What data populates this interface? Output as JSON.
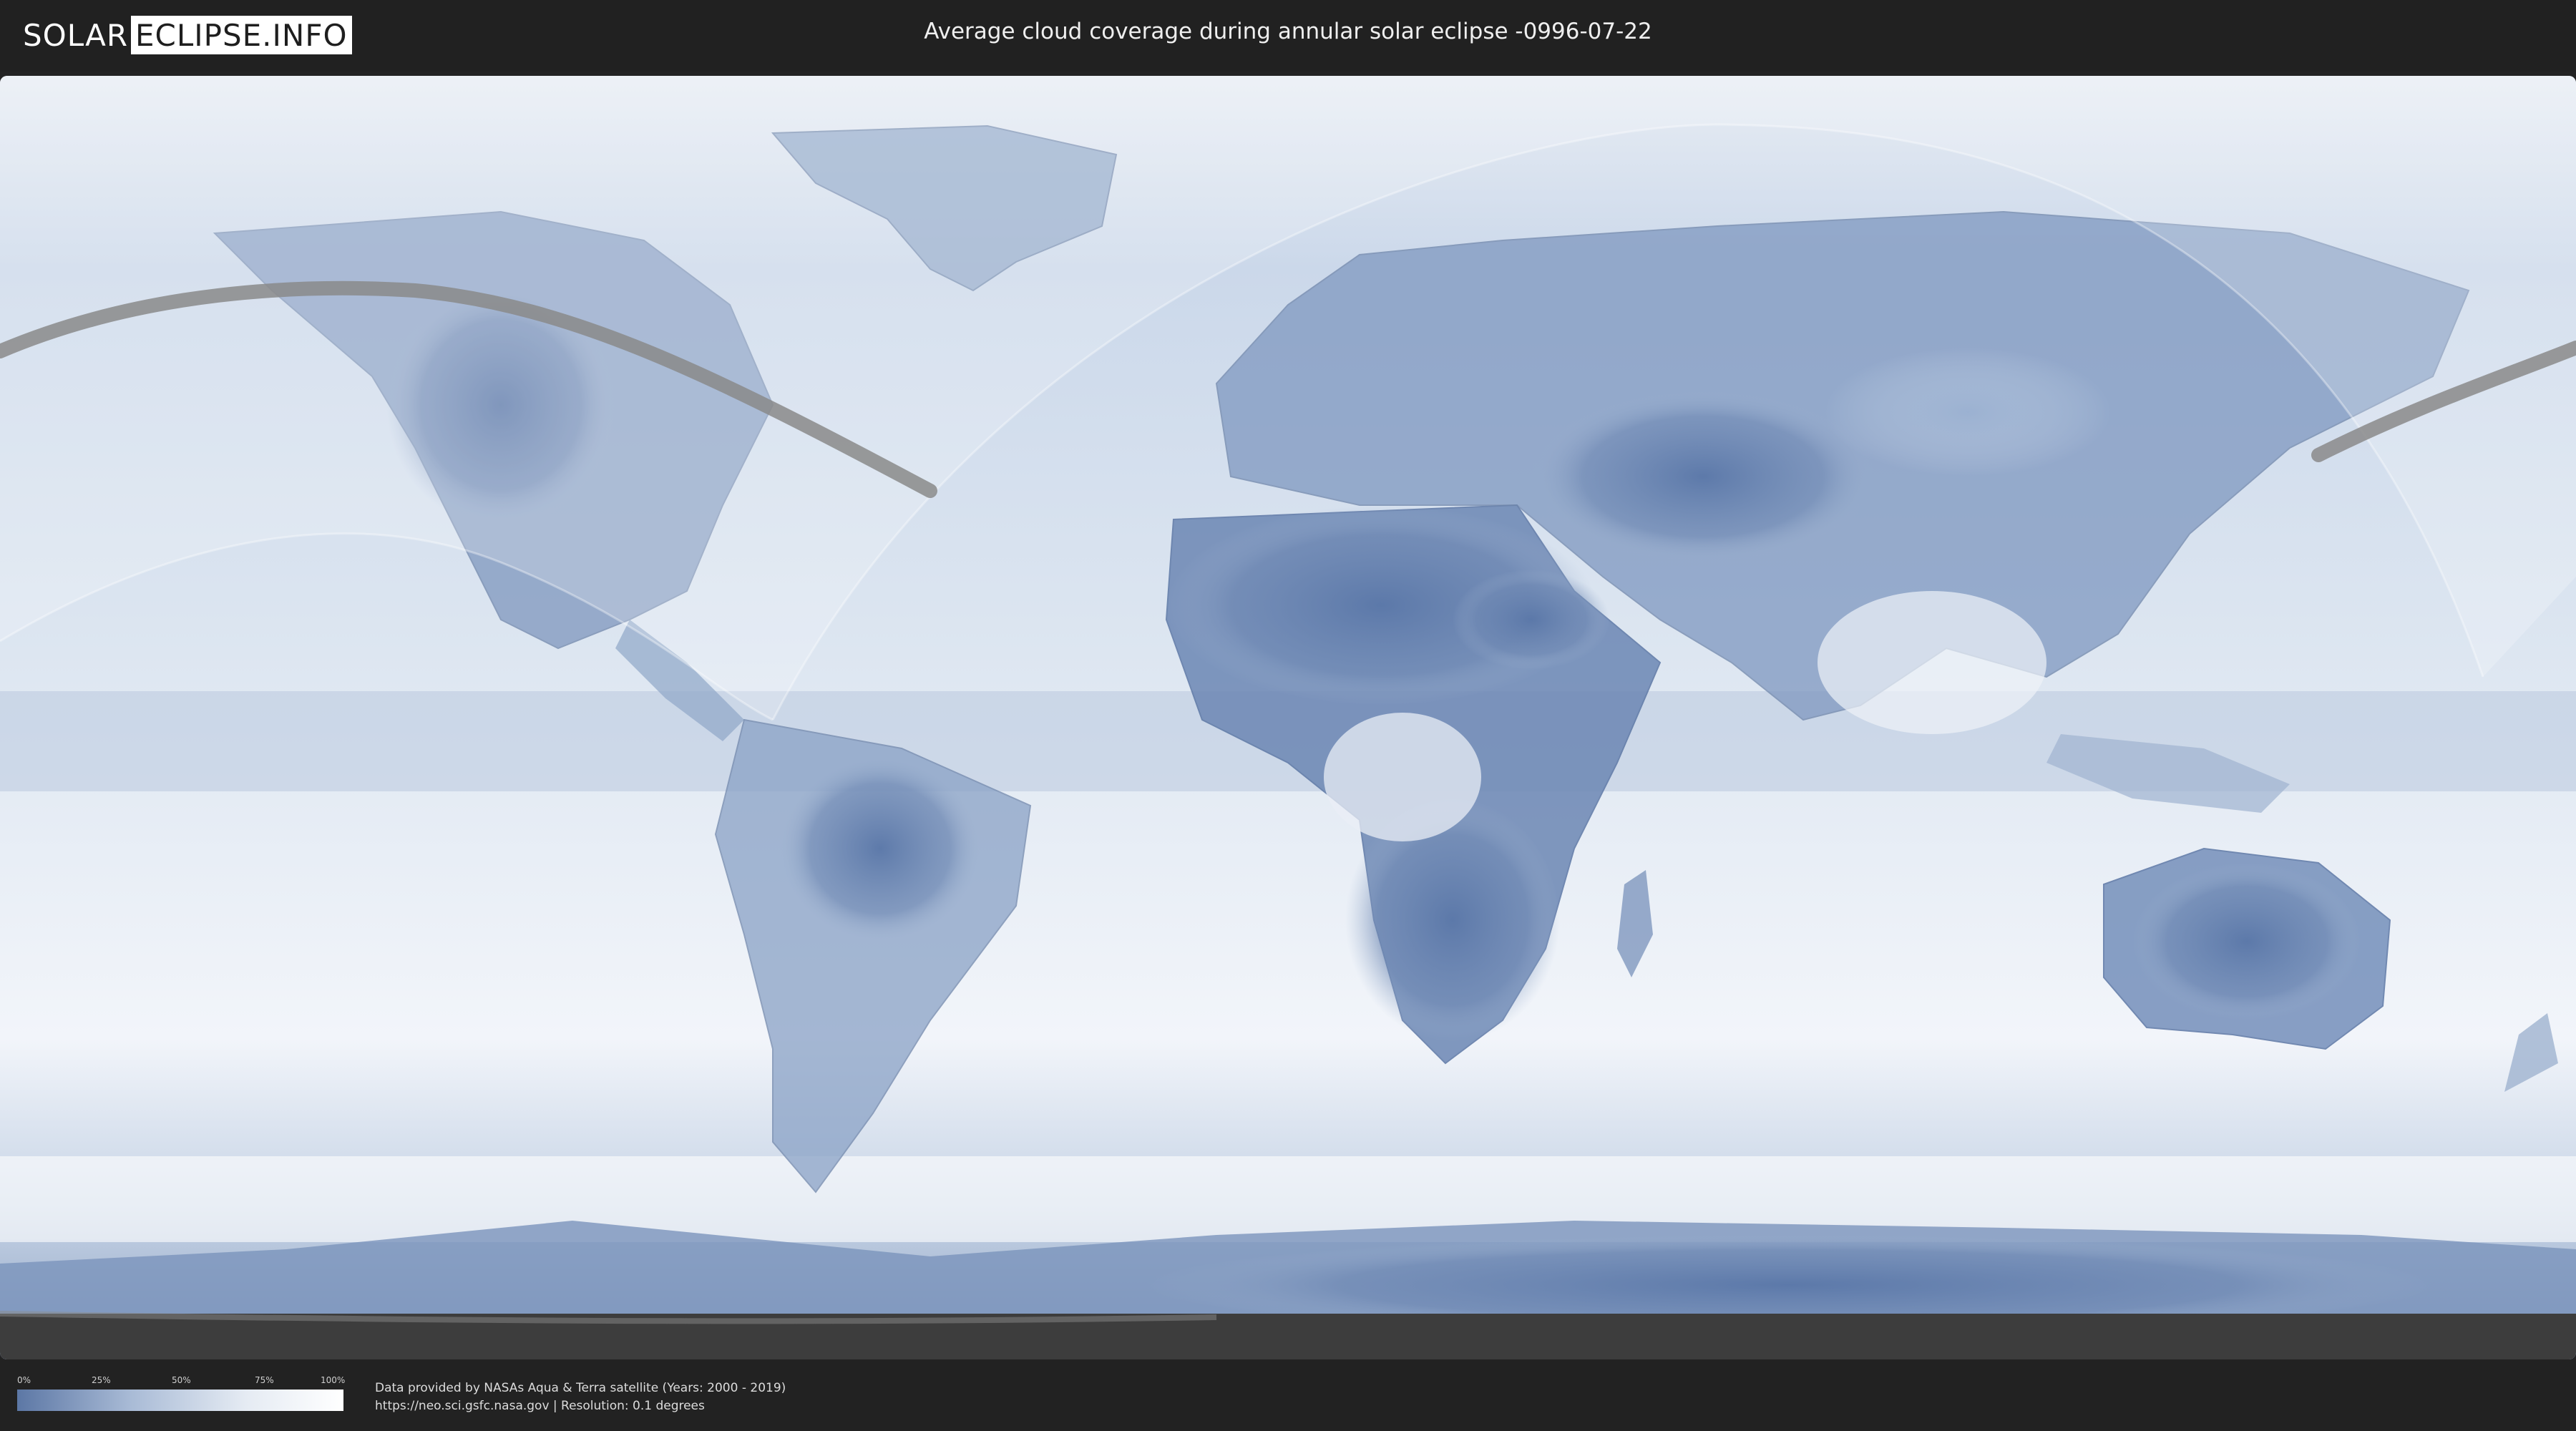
{
  "header": {
    "logo_left": "SOLAR",
    "logo_right": "ECLIPSE.INFO",
    "title": "Average cloud coverage during annular solar eclipse -0996-07-22"
  },
  "map": {
    "type": "world cloud coverage map",
    "projection": "equirectangular",
    "colors": {
      "low_cloud": "#5c77a5",
      "high_cloud": "#ffffff",
      "eclipse_path": "#8a8a8a",
      "visibility_overlay": "#ffffff"
    }
  },
  "legend": {
    "ticks": [
      "0%",
      "25%",
      "50%",
      "75%",
      "100%"
    ]
  },
  "footer": {
    "credit_line1": "Data provided by NASAs Aqua & Terra satellite (Years: 2000 - 2019)",
    "credit_line2": "https://neo.sci.gsfc.nasa.gov | Resolution: 0.1 degrees"
  }
}
